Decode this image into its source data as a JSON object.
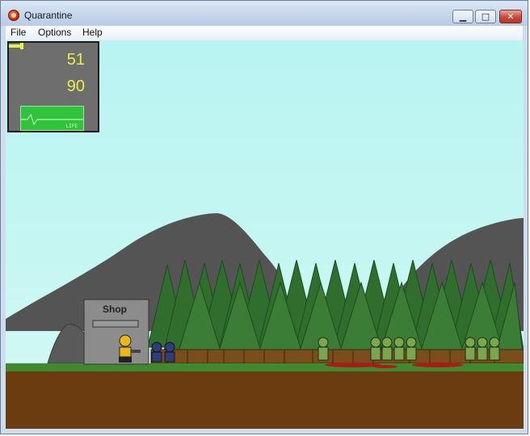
{
  "window": {
    "title": "Quarantine"
  },
  "menu": [
    {
      "label": "File"
    },
    {
      "label": "Options"
    },
    {
      "label": "Help"
    }
  ],
  "hud": {
    "ammo": "51",
    "health": "90",
    "monitor_label": "LIFE"
  },
  "scene": {
    "shop_label": "Shop"
  },
  "colors": {
    "sky": "#bff5f2",
    "grass": "#3f8a2e",
    "dirt": "#6a3c10",
    "hills": "#545454",
    "trees": "#2f6e2c",
    "hud_text": "#e6f04a",
    "life_monitor": "#2fc43a"
  }
}
